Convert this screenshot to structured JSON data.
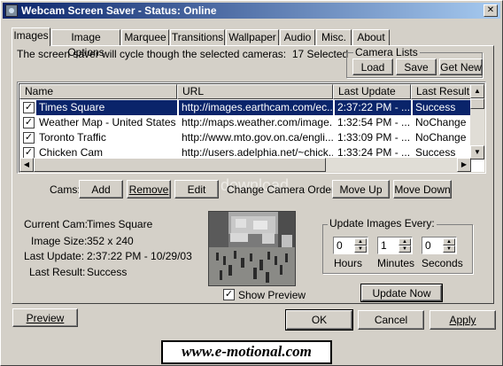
{
  "window": {
    "title": "Webcam Screen Saver - Status: Online",
    "close_glyph": "✕"
  },
  "tabs": [
    {
      "label": "Images",
      "active": true
    },
    {
      "label": "Image Options"
    },
    {
      "label": "Marquee"
    },
    {
      "label": "Transitions"
    },
    {
      "label": "Wallpaper"
    },
    {
      "label": "Audio"
    },
    {
      "label": "Misc."
    },
    {
      "label": "About"
    }
  ],
  "images_tab": {
    "cycle_text": "The screen saver will cycle though the selected cameras:",
    "selected_count": "17 Selected",
    "camera_lists": {
      "title": "Camera Lists",
      "load": "Load",
      "save": "Save",
      "get_new": "Get New"
    },
    "columns": [
      "Name",
      "URL",
      "Last Update",
      "Last Result"
    ],
    "rows": [
      {
        "name": "Times Square",
        "url": "http://images.earthcam.com/ec...",
        "last_update": "2:37:22 PM - ...",
        "last_result": "Success",
        "checked": true,
        "selected": true
      },
      {
        "name": "Weather Map - United States",
        "url": "http://maps.weather.com/image...",
        "last_update": "1:32:54 PM - ...",
        "last_result": "NoChange",
        "checked": true
      },
      {
        "name": "Toronto Traffic",
        "url": "http://www.mto.gov.on.ca/engli...",
        "last_update": "1:33:09 PM - ...",
        "last_result": "NoChange",
        "checked": true
      },
      {
        "name": "Chicken Cam",
        "url": "http://users.adelphia.net/~chick...",
        "last_update": "1:33:24 PM - ...",
        "last_result": "Success",
        "checked": true
      }
    ],
    "cams_label": "Cams:",
    "add": "Add",
    "remove": "Remove",
    "edit": "Edit",
    "change_order_label": "Change Camera Order:",
    "move_up": "Move Up",
    "move_down": "Move Down",
    "details": {
      "current_cam_label": "Current Cam:",
      "current_cam": "Times Square",
      "image_size_label": "Image Size:",
      "image_size": "352 x 240",
      "last_update_label": "Last Update:",
      "last_update": "2:37:22 PM - 10/29/03",
      "last_result_label": "Last Result:",
      "last_result": "Success"
    },
    "show_preview": "Show Preview",
    "update_every": {
      "title": "Update Images Every:",
      "hours_value": "0",
      "hours_label": "Hours",
      "minutes_value": "1",
      "minutes_label": "Minutes",
      "seconds_value": "0",
      "seconds_label": "Seconds"
    },
    "update_now": "Update Now"
  },
  "footer": {
    "preview": "Preview",
    "ok": "OK",
    "cancel": "Cancel",
    "apply": "Apply"
  },
  "banner": "www.e-motional.com",
  "watermark": "download",
  "colors": {
    "titlebar_start": "#0a246a",
    "titlebar_end": "#a6caf0",
    "selection": "#0a246a",
    "face": "#d4d0c8"
  }
}
